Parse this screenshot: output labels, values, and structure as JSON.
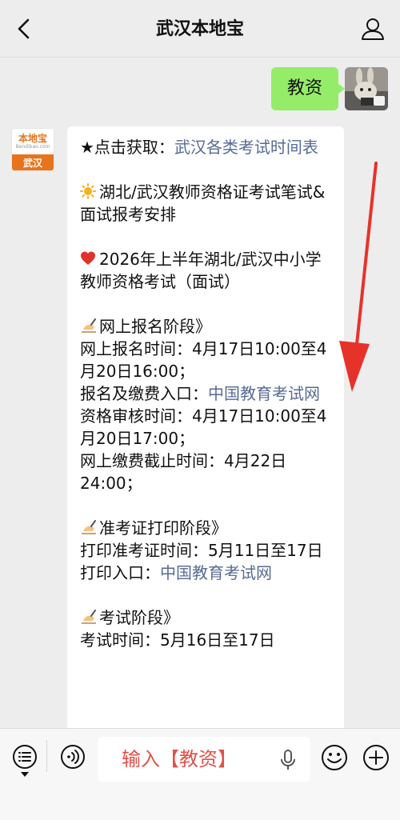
{
  "navbar": {
    "title": "武汉本地宝",
    "back_icon": "chevron-left-icon",
    "profile_icon": "person-icon"
  },
  "sent_message": {
    "text": "教资"
  },
  "account_avatar": {
    "logo_text": "本地宝",
    "logo_sub": "Bendibao.com",
    "city": "武汉"
  },
  "reply": {
    "line1_prefix": "★点击获取：",
    "line1_link": "武汉各类考试时间表",
    "line2_emoji": "☀",
    "line2": "湖北/武汉教师资格证考试笔试&面试报考安排",
    "line3_emoji": "❤",
    "line3": "2026年上半年湖北/武汉中小学教师资格考试（面试）",
    "sec1_emoji": "✍",
    "sec1_title": "网上报名阶段》",
    "reg_time": "网上报名时间：4月17日10:00至4月20日16:00；",
    "reg_entry_prefix": "报名及缴费入口：",
    "reg_entry_link": "中国教育考试网",
    "review_time": "资格审核时间：4月17日10:00至4月20日17:00；",
    "pay_deadline": "网上缴费截止时间：4月22日24:00；",
    "sec2_emoji": "✍",
    "sec2_title": "准考证打印阶段》",
    "print_time": "打印准考证时间：5月11日至17日",
    "print_entry_prefix": "打印入口：",
    "print_entry_link": "中国教育考试网",
    "sec3_emoji": "✍",
    "sec3_title": "考试阶段》",
    "exam_time": "考试时间：5月16日至17日"
  },
  "input_bar": {
    "text": "输入【教资】",
    "menu_icon": "menu-list-icon",
    "voice_icon": "voice-icon",
    "mic_icon": "microphone-icon",
    "emoji_icon": "emoji-icon",
    "plus_icon": "plus-icon"
  },
  "colors": {
    "background": "#ededed",
    "sent_bubble": "#95ec69",
    "link": "#576b95",
    "accent_orange": "#e8731d",
    "annotation_red": "#e6332a",
    "input_hint": "#e05149"
  }
}
